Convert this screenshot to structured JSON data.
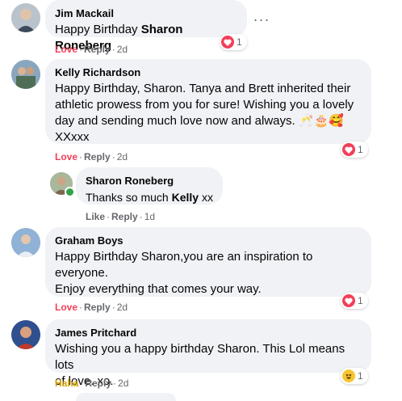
{
  "comments": [
    {
      "author": "Jim Mackail",
      "text_pre": "Happy Birthday ",
      "text_bold": "Sharon Roneberg",
      "reaction": "Love",
      "reply": "Reply",
      "time": "2d",
      "reaction_count": "1",
      "more_label": "···"
    },
    {
      "author": "Kelly Richardson",
      "line1": "Happy Birthday, Sharon. Tanya and Brett inherited their",
      "line2": "athletic prowess from you for sure! Wishing you a lovely",
      "line3": "day and sending much love now and always. ",
      "emojis": "🥂🎂🥰",
      "line4": "XXxxx",
      "reaction": "Love",
      "reply": "Reply",
      "time": "2d",
      "reaction_count": "1"
    },
    {
      "author": "Sharon Roneberg",
      "text_pre": "Thanks so much ",
      "text_bold": "Kelly",
      "text_post": " xx",
      "reaction": "Like",
      "reply": "Reply",
      "time": "1d"
    },
    {
      "author": "Graham Boys",
      "line1": "Happy Birthday Sharon,you are an inspiration to",
      "line2": "everyone.",
      "line3": "Enjoy everything that comes your way.",
      "reaction": "Love",
      "reply": "Reply",
      "time": "2d",
      "reaction_count": "1"
    },
    {
      "author": "James Pritchard",
      "line1": "Wishing you a happy birthday Sharon. This Lol means lots",
      "line2": "of love. xo.",
      "reaction": "Haha",
      "reply": "Reply",
      "time": "2d",
      "reaction_count": "1"
    }
  ],
  "separator": "·",
  "colors": {
    "love": "#f33e58",
    "haha": "#d7a200",
    "meta": "#65676b",
    "bubble": "#f0f2f5",
    "online": "#31a24c"
  },
  "icons": {
    "love_reaction": "heart-icon",
    "haha_reaction": "laughing-face-icon",
    "more": "ellipsis-icon"
  }
}
